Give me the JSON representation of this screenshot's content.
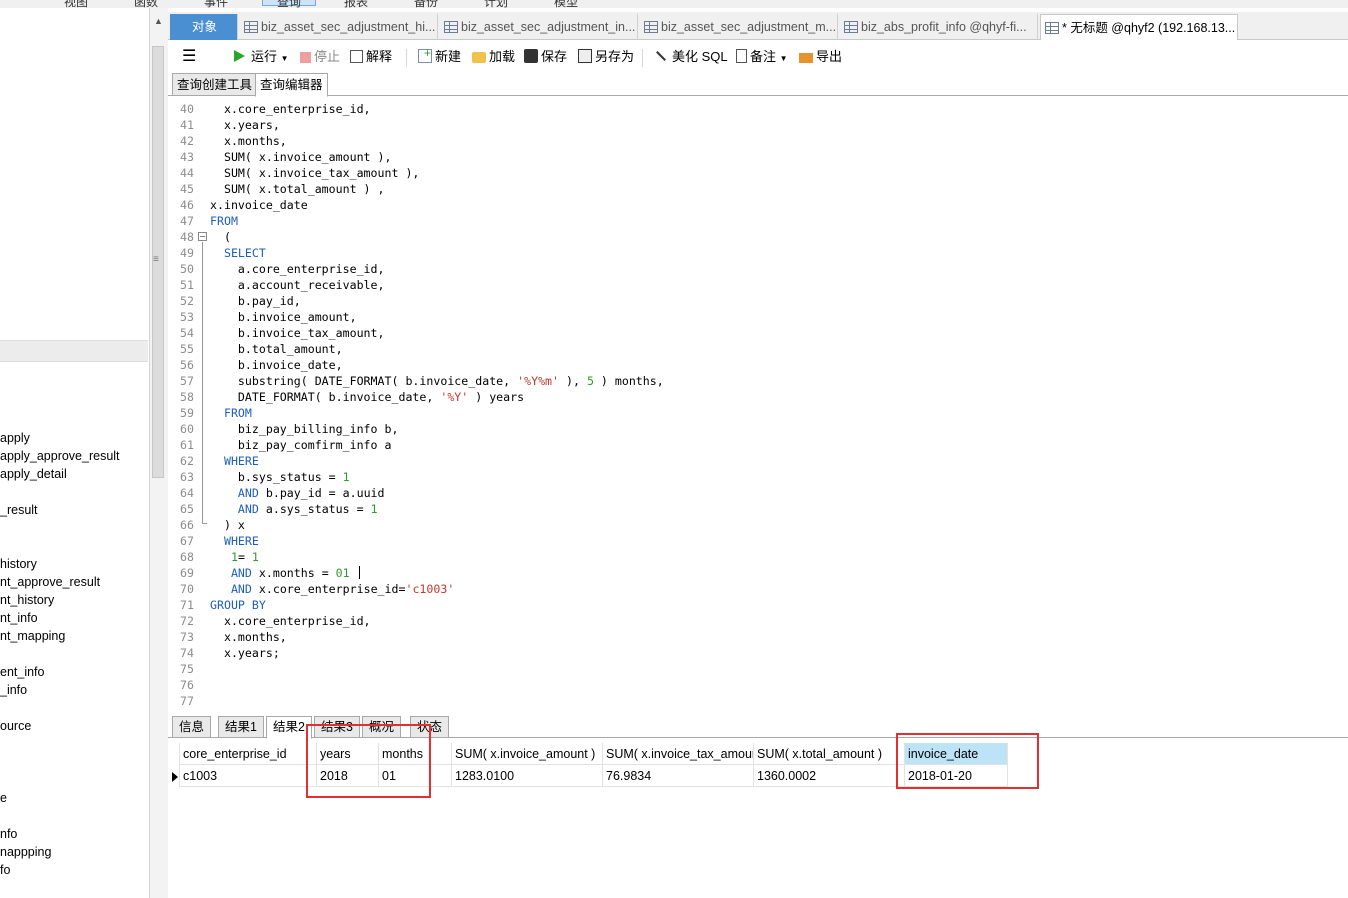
{
  "menubar": {
    "items": [
      "视图",
      "函数",
      "事件",
      "查询",
      "报表",
      "备份",
      "计划",
      "模型"
    ],
    "active_index": 3
  },
  "sidebar": {
    "items": [
      "apply",
      "apply_approve_result",
      "apply_detail",
      "_result",
      "history",
      "nt_approve_result",
      "nt_history",
      "nt_info",
      "nt_mapping",
      "ent_info",
      "_info",
      "ource",
      "e",
      "nfo",
      "nappping",
      "fo"
    ]
  },
  "tabs": [
    {
      "label": "对象"
    },
    {
      "label": "biz_asset_sec_adjustment_hi..."
    },
    {
      "label": "biz_asset_sec_adjustment_in..."
    },
    {
      "label": "biz_asset_sec_adjustment_m..."
    },
    {
      "label": "biz_abs_profit_info @qhyf-fi..."
    },
    {
      "label": "* 无标题 @qhyf2 (192.168.13..."
    }
  ],
  "toolbar": {
    "run": "运行",
    "stop": "停止",
    "explain": "解释",
    "new": "新建",
    "load": "加载",
    "save": "保存",
    "save_as": "另存为",
    "beautify": "美化 SQL",
    "note": "备注",
    "export": "导出"
  },
  "subtabs": [
    "查询创建工具",
    "查询编辑器"
  ],
  "editor": {
    "lines": [
      {
        "n": "40",
        "segs": [
          [
            "  x.core_enterprise_id,",
            ""
          ]
        ]
      },
      {
        "n": "41",
        "segs": [
          [
            "  x.years,",
            ""
          ]
        ]
      },
      {
        "n": "42",
        "segs": [
          [
            "  x.months,",
            ""
          ]
        ]
      },
      {
        "n": "43",
        "segs": [
          [
            "  SUM( x.invoice_amount ),",
            ""
          ]
        ]
      },
      {
        "n": "44",
        "segs": [
          [
            "  SUM( x.invoice_tax_amount ),",
            ""
          ]
        ]
      },
      {
        "n": "45",
        "segs": [
          [
            "  SUM( x.total_amount ) ,",
            ""
          ]
        ]
      },
      {
        "n": "46",
        "segs": [
          [
            "x.invoice_date",
            ""
          ]
        ]
      },
      {
        "n": "47",
        "segs": [
          [
            "FROM",
            "kw"
          ]
        ]
      },
      {
        "n": "48",
        "segs": [
          [
            "  (",
            ""
          ]
        ]
      },
      {
        "n": "49",
        "segs": [
          [
            "  ",
            ""
          ],
          [
            "SELECT",
            "kw"
          ]
        ]
      },
      {
        "n": "50",
        "segs": [
          [
            "    a.core_enterprise_id,",
            ""
          ]
        ]
      },
      {
        "n": "51",
        "segs": [
          [
            "    a.account_receivable,",
            ""
          ]
        ]
      },
      {
        "n": "52",
        "segs": [
          [
            "    b.pay_id,",
            ""
          ]
        ]
      },
      {
        "n": "53",
        "segs": [
          [
            "    b.invoice_amount,",
            ""
          ]
        ]
      },
      {
        "n": "54",
        "segs": [
          [
            "    b.invoice_tax_amount,",
            ""
          ]
        ]
      },
      {
        "n": "55",
        "segs": [
          [
            "    b.total_amount,",
            ""
          ]
        ]
      },
      {
        "n": "56",
        "segs": [
          [
            "    b.invoice_date,",
            ""
          ]
        ]
      },
      {
        "n": "57",
        "segs": [
          [
            "    substring( DATE_FORMAT( b.invoice_date, ",
            ""
          ],
          [
            "'%Y%m'",
            "str"
          ],
          [
            " ), ",
            ""
          ],
          [
            "5",
            "num"
          ],
          [
            " ) months,",
            ""
          ]
        ]
      },
      {
        "n": "58",
        "segs": [
          [
            "    DATE_FORMAT( b.invoice_date, ",
            ""
          ],
          [
            "'%Y'",
            "str"
          ],
          [
            " ) years",
            ""
          ]
        ]
      },
      {
        "n": "59",
        "segs": [
          [
            "  ",
            ""
          ],
          [
            "FROM",
            "kw"
          ]
        ]
      },
      {
        "n": "60",
        "segs": [
          [
            "    biz_pay_billing_info b,",
            ""
          ]
        ]
      },
      {
        "n": "61",
        "segs": [
          [
            "    biz_pay_comfirm_info a",
            ""
          ]
        ]
      },
      {
        "n": "62",
        "segs": [
          [
            "  ",
            ""
          ],
          [
            "WHERE",
            "kw"
          ]
        ]
      },
      {
        "n": "63",
        "segs": [
          [
            "    b.sys_status = ",
            ""
          ],
          [
            "1",
            "num"
          ]
        ]
      },
      {
        "n": "64",
        "segs": [
          [
            "    ",
            ""
          ],
          [
            "AND",
            "kw"
          ],
          [
            " b.pay_id = a.uuid",
            ""
          ]
        ]
      },
      {
        "n": "65",
        "segs": [
          [
            "    ",
            ""
          ],
          [
            "AND",
            "kw"
          ],
          [
            " a.sys_status = ",
            ""
          ],
          [
            "1",
            "num"
          ]
        ]
      },
      {
        "n": "66",
        "segs": [
          [
            "  ) x",
            ""
          ]
        ]
      },
      {
        "n": "67",
        "segs": [
          [
            "  ",
            ""
          ],
          [
            "WHERE",
            "kw"
          ]
        ]
      },
      {
        "n": "68",
        "segs": [
          [
            "   ",
            ""
          ],
          [
            "1",
            "num"
          ],
          [
            "= ",
            ""
          ],
          [
            "1",
            "num"
          ]
        ]
      },
      {
        "n": "69",
        "segs": [
          [
            "   ",
            ""
          ],
          [
            "AND",
            "kw"
          ],
          [
            " x.months = ",
            ""
          ],
          [
            "01",
            "num"
          ],
          [
            " ",
            ""
          ]
        ],
        "caret": true
      },
      {
        "n": "70",
        "segs": [
          [
            "   ",
            ""
          ],
          [
            "AND",
            "kw"
          ],
          [
            " x.core_enterprise_id=",
            ""
          ],
          [
            "'c1003'",
            "str"
          ]
        ]
      },
      {
        "n": "71",
        "segs": [
          [
            "GROUP BY",
            "kw"
          ]
        ]
      },
      {
        "n": "72",
        "segs": [
          [
            "  x.core_enterprise_id,",
            ""
          ]
        ]
      },
      {
        "n": "73",
        "segs": [
          [
            "  x.months,",
            ""
          ]
        ]
      },
      {
        "n": "74",
        "segs": [
          [
            "  x.years;",
            ""
          ]
        ]
      },
      {
        "n": "75",
        "segs": []
      },
      {
        "n": "76",
        "segs": []
      },
      {
        "n": "77",
        "segs": []
      }
    ]
  },
  "result_tabs": [
    "信息",
    "结果1",
    "结果2",
    "结果3",
    "概况",
    "状态"
  ],
  "result_tab_active": 2,
  "grid": {
    "columns": [
      "core_enterprise_id",
      "years",
      "months",
      "SUM( x.invoice_amount )",
      "SUM( x.invoice_tax_amount )",
      "SUM( x.total_amount )",
      "invoice_date"
    ],
    "rows": [
      [
        "c1003",
        "2018",
        "01",
        "1283.0100",
        "76.9834",
        "1360.0002",
        "2018-01-20"
      ]
    ]
  },
  "colors": {
    "keyword": "#1c5fbd",
    "number": "#2d9b2d",
    "string": "#c0392b",
    "annotation": "#e03030",
    "object_tab": "#4a8fd1"
  }
}
